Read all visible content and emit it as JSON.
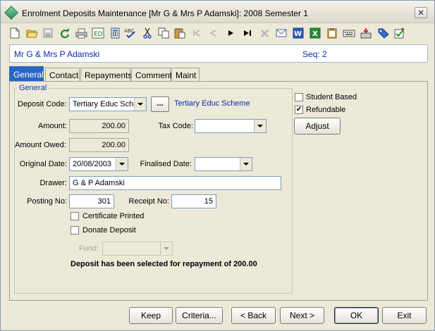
{
  "window": {
    "title": "Enrolment Deposits Maintenance  [Mr G & Mrs P Adamski]:  2008 Semester 1",
    "close_glyph": "✕"
  },
  "toolbar": {
    "buttons": [
      {
        "name": "new-icon"
      },
      {
        "name": "open-folder-icon"
      },
      {
        "name": "save-icon"
      },
      {
        "name": "refresh-icon"
      },
      {
        "name": "print-icon"
      },
      {
        "name": "edit-icon"
      },
      {
        "name": "calculator-icon"
      },
      {
        "name": "spellcheck-icon"
      },
      {
        "name": "cut-icon"
      },
      {
        "name": "copy-icon"
      },
      {
        "name": "paste-icon"
      },
      {
        "name": "first-record-icon"
      },
      {
        "name": "previous-record-icon"
      },
      {
        "name": "next-record-icon"
      },
      {
        "name": "last-record-icon"
      },
      {
        "name": "delete-icon"
      },
      {
        "name": "email-icon"
      },
      {
        "name": "word-icon"
      },
      {
        "name": "excel-icon"
      },
      {
        "name": "clipboard-icon"
      },
      {
        "name": "keyboard-icon"
      },
      {
        "name": "merge-icon"
      },
      {
        "name": "tag-icon"
      },
      {
        "name": "tick-list-icon"
      }
    ]
  },
  "header": {
    "name": "Mr G & Mrs P Adamski",
    "seq": "Seq: 2"
  },
  "tabs": [
    {
      "label": "General",
      "active": true
    },
    {
      "label": "Contact"
    },
    {
      "label": "Repayments"
    },
    {
      "label": "Comment"
    },
    {
      "label": "Maint"
    }
  ],
  "form": {
    "group_title": "General",
    "deposit_code_label": "Deposit Code:",
    "deposit_code_value": "Tertiary Educ Sche",
    "ellipsis": "...",
    "deposit_code_desc": "Tertiary Educ Scheme",
    "amount_label": "Amount:",
    "amount_value": "200.00",
    "tax_code_label": "Tax Code:",
    "tax_code_value": "",
    "amount_owed_label": "Amount Owed:",
    "amount_owed_value": "200.00",
    "original_date_label": "Original Date:",
    "original_date_value": "20/08/2003",
    "finalised_date_label": "Finalised Date:",
    "finalised_date_value": "",
    "drawer_label": "Drawer:",
    "drawer_value": "G & P Adamski",
    "posting_no_label": "Posting No:",
    "posting_no_value": "301",
    "receipt_no_label": "Receipt No:",
    "receipt_no_value": "15",
    "certificate_printed_label": "Certificate Printed",
    "donate_deposit_label": "Donate Deposit",
    "fund_label": "Fund:",
    "fund_value": "",
    "repayment_message": "Deposit has been selected  for repayment of 200.00"
  },
  "right_panel": {
    "student_based_label": "Student Based",
    "refundable_label": "Refundable",
    "refundable_check": "✔",
    "adjust_label": "Adjust"
  },
  "bottom": {
    "keep": "Keep",
    "criteria": "Criteria...",
    "back": "< Back",
    "next": "Next >",
    "ok": "OK",
    "exit": "Exit"
  }
}
